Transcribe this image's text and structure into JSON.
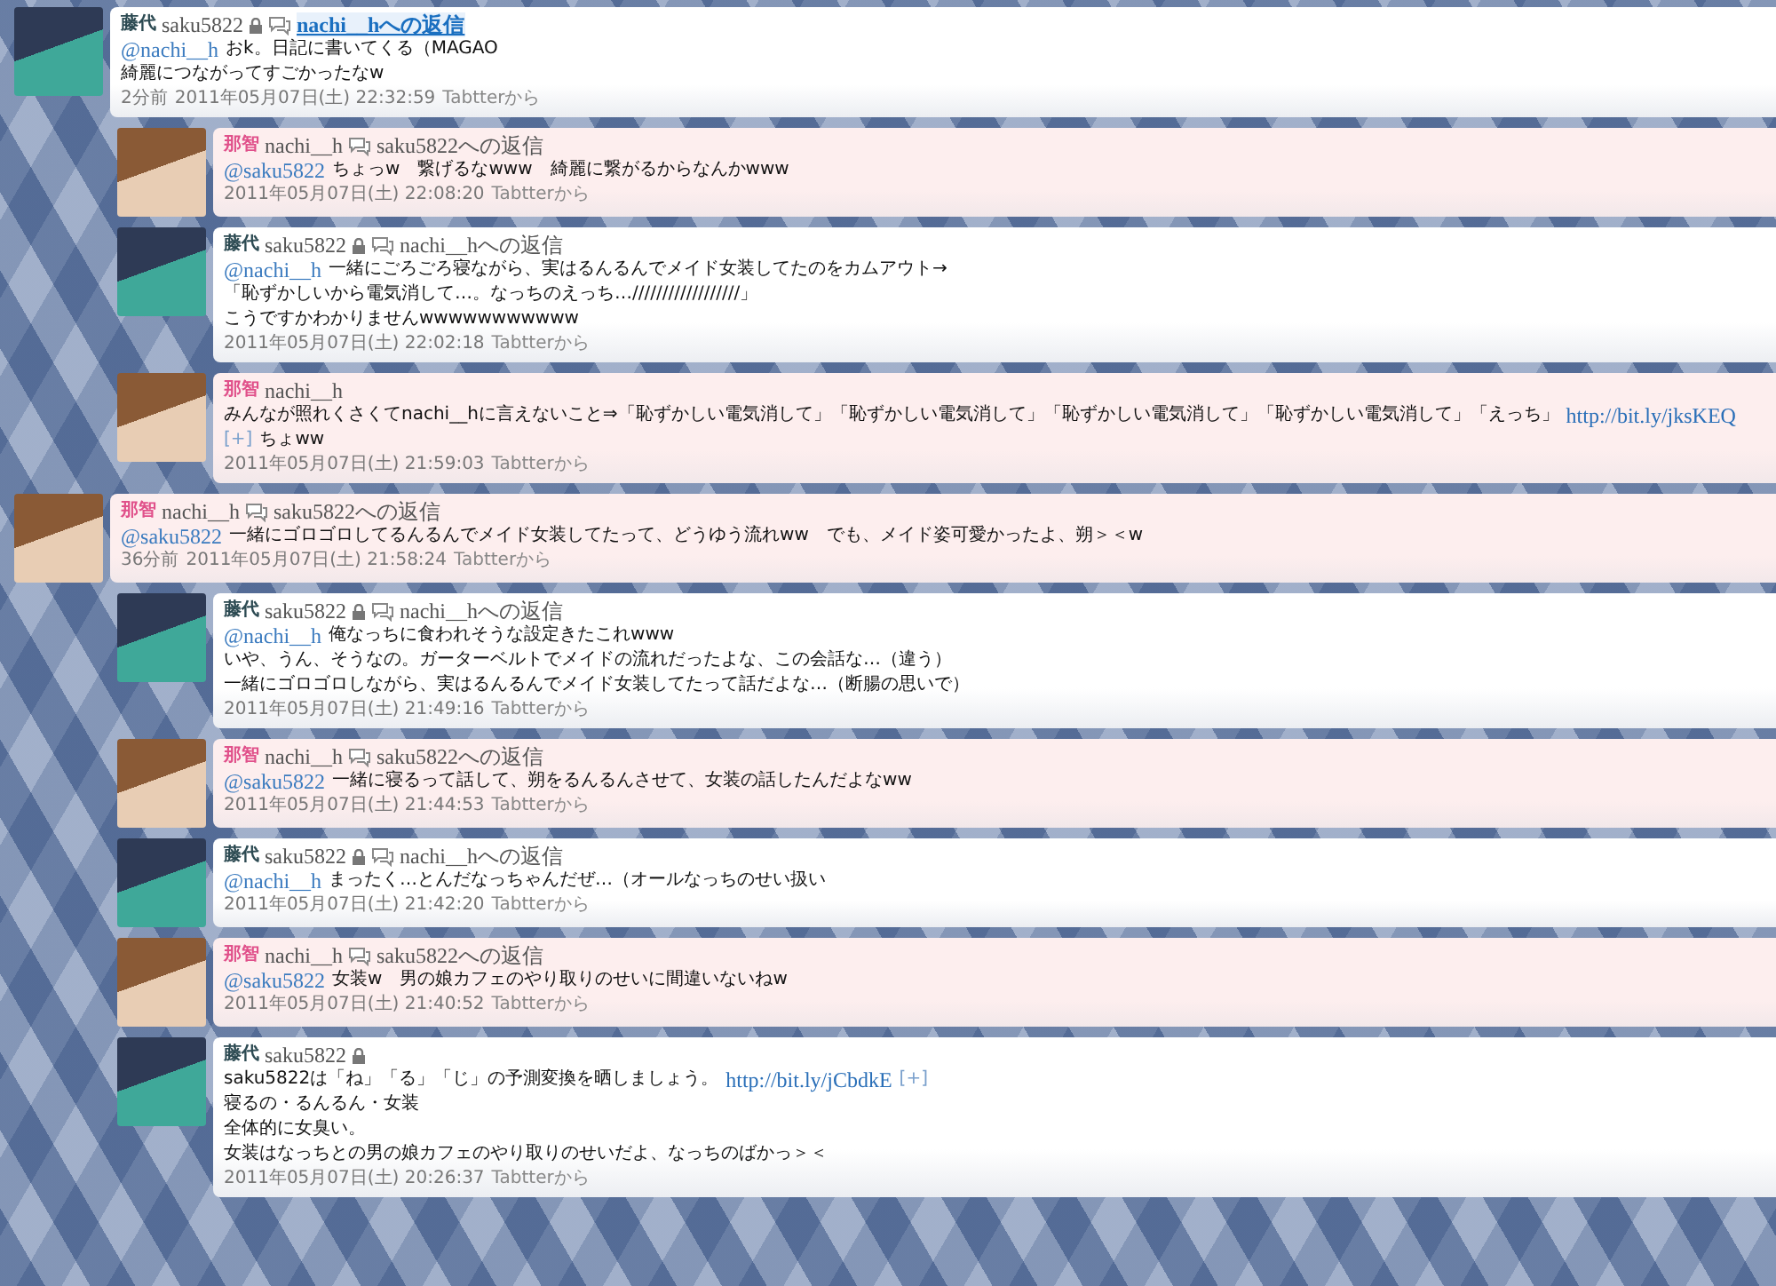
{
  "tweets": [
    {
      "kind": "own",
      "name": "藤代",
      "handle": "saku5822",
      "locked": true,
      "reply_to": "nachi__hへの返信",
      "hovered": true,
      "lines": [
        [
          {
            "kind": "mention",
            "text": "@nachi__h"
          },
          {
            "kind": "text",
            "text": "おk。日記に書いてくる（MAGAO"
          }
        ],
        [
          {
            "kind": "text",
            "text": "綺麗につながってすごかったなw"
          }
        ]
      ],
      "age": "2分前",
      "time": "2011年05月07日(土) 22:32:59",
      "source": "Tabtterから",
      "children": [
        {
          "kind": "other",
          "name": "那智",
          "handle": "nachi__h",
          "locked": false,
          "reply_to": "saku5822への返信",
          "hovered": false,
          "lines": [
            [
              {
                "kind": "mention",
                "text": "@saku5822"
              },
              {
                "kind": "text",
                "text": "ちょっw　繋げるなwww　綺麗に繋がるからなんかwww"
              }
            ]
          ],
          "time": "2011年05月07日(土) 22:08:20",
          "source": "Tabtterから"
        },
        {
          "kind": "own",
          "name": "藤代",
          "handle": "saku5822",
          "locked": true,
          "reply_to": "nachi__hへの返信",
          "hovered": false,
          "lines": [
            [
              {
                "kind": "mention",
                "text": "@nachi__h"
              },
              {
                "kind": "text",
                "text": "一緒にごろごろ寝ながら、実はるんるんでメイド女装してたのをカムアウト→"
              }
            ],
            [
              {
                "kind": "text",
                "text": "「恥ずかしいから電気消して…。なっちのえっち…//////////////////」"
              }
            ],
            [
              {
                "kind": "text",
                "text": "こうですかわかりませんwwwwwwwwwww"
              }
            ]
          ],
          "time": "2011年05月07日(土) 22:02:18",
          "source": "Tabtterから"
        },
        {
          "kind": "other",
          "name": "那智",
          "handle": "nachi__h",
          "locked": false,
          "lines": [
            [
              {
                "kind": "text",
                "text": "みんなが照れくさくてnachi__hに言えないこと⇒「恥ずかしい電気消して」「恥ずかしい電気消して」「恥ずかしい電気消して」「恥ずかしい電気消して」「えっち」"
              },
              {
                "kind": "link",
                "text": "http://bit.ly/jksKEQ"
              },
              {
                "kind": "expand",
                "text": "[+]"
              },
              {
                "kind": "text",
                "text": "ちょww"
              }
            ]
          ],
          "time": "2011年05月07日(土) 21:59:03",
          "source": "Tabtterから"
        }
      ]
    },
    {
      "kind": "other",
      "name": "那智",
      "handle": "nachi__h",
      "locked": false,
      "reply_to": "saku5822への返信",
      "hovered": false,
      "lines": [
        [
          {
            "kind": "mention",
            "text": "@saku5822"
          },
          {
            "kind": "text",
            "text": "一緒にゴロゴロしてるんるんでメイド女装してたって、どうゆう流れww　でも、メイド姿可愛かったよ、朔＞＜w"
          }
        ]
      ],
      "age": "36分前",
      "time": "2011年05月07日(土) 21:58:24",
      "source": "Tabtterから",
      "children": [
        {
          "kind": "own",
          "name": "藤代",
          "handle": "saku5822",
          "locked": true,
          "reply_to": "nachi__hへの返信",
          "hovered": false,
          "lines": [
            [
              {
                "kind": "mention",
                "text": "@nachi__h"
              },
              {
                "kind": "text",
                "text": "俺なっちに食われそうな設定きたこれwww"
              }
            ],
            [
              {
                "kind": "text",
                "text": "いや、うん、そうなの。ガーターベルトでメイドの流れだったよな、この会話な…（違う）"
              }
            ],
            [
              {
                "kind": "text",
                "text": "一緒にゴロゴロしながら、実はるんるんでメイド女装してたって話だよな…（断腸の思いで）"
              }
            ]
          ],
          "time": "2011年05月07日(土) 21:49:16",
          "source": "Tabtterから"
        },
        {
          "kind": "other",
          "name": "那智",
          "handle": "nachi__h",
          "locked": false,
          "reply_to": "saku5822への返信",
          "hovered": false,
          "lines": [
            [
              {
                "kind": "mention",
                "text": "@saku5822"
              },
              {
                "kind": "text",
                "text": "一緒に寝るって話して、朔をるんるんさせて、女装の話したんだよなww"
              }
            ]
          ],
          "time": "2011年05月07日(土) 21:44:53",
          "source": "Tabtterから"
        },
        {
          "kind": "own",
          "name": "藤代",
          "handle": "saku5822",
          "locked": true,
          "reply_to": "nachi__hへの返信",
          "hovered": false,
          "lines": [
            [
              {
                "kind": "mention",
                "text": "@nachi__h"
              },
              {
                "kind": "text",
                "text": "まったく…とんだなっちゃんだぜ…（オールなっちのせい扱い"
              }
            ]
          ],
          "time": "2011年05月07日(土) 21:42:20",
          "source": "Tabtterから"
        },
        {
          "kind": "other",
          "name": "那智",
          "handle": "nachi__h",
          "locked": false,
          "reply_to": "saku5822への返信",
          "hovered": false,
          "lines": [
            [
              {
                "kind": "mention",
                "text": "@saku5822"
              },
              {
                "kind": "text",
                "text": "女装w　男の娘カフェのやり取りのせいに間違いないねw"
              }
            ]
          ],
          "time": "2011年05月07日(土) 21:40:52",
          "source": "Tabtterから"
        },
        {
          "kind": "own",
          "name": "藤代",
          "handle": "saku5822",
          "locked": true,
          "lines": [
            [
              {
                "kind": "text",
                "text": "saku5822は「ね」「る」「じ」の予測変換を晒しましょう。"
              },
              {
                "kind": "link",
                "text": "http://bit.ly/jCbdkE"
              },
              {
                "kind": "expand",
                "text": "[+]"
              }
            ],
            [
              {
                "kind": "text",
                "text": "寝るの・るんるん・女装"
              }
            ],
            [
              {
                "kind": "text",
                "text": "全体的に女臭い。"
              }
            ],
            [
              {
                "kind": "text",
                "text": "女装はなっちとの男の娘カフェのやり取りのせいだよ、なっちのばかっ＞＜"
              }
            ]
          ],
          "time": "2011年05月07日(土) 20:26:37",
          "source": "Tabtterから"
        }
      ]
    }
  ]
}
